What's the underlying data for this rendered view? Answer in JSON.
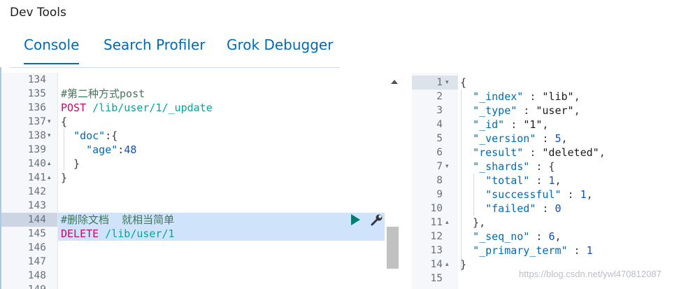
{
  "app": {
    "title": "Dev Tools"
  },
  "tabs": [
    {
      "label": "Console",
      "active": true
    },
    {
      "label": "Search Profiler",
      "active": false
    },
    {
      "label": "Grok Debugger",
      "active": false
    }
  ],
  "request_editor": {
    "lines": [
      {
        "n": "134",
        "fold": "",
        "tokens": []
      },
      {
        "n": "135",
        "fold": "",
        "tokens": [
          {
            "t": "#第二种方式post",
            "c": "comment"
          }
        ]
      },
      {
        "n": "136",
        "fold": "",
        "tokens": [
          {
            "t": "POST ",
            "c": "method"
          },
          {
            "t": "/lib/user/1/_update",
            "c": "url"
          }
        ]
      },
      {
        "n": "137",
        "fold": "▾",
        "tokens": [
          {
            "t": "{",
            "c": "plain"
          }
        ]
      },
      {
        "n": "138",
        "fold": "▾",
        "tokens": [
          {
            "t": "  ",
            "c": "plain"
          },
          {
            "t": "\"doc\"",
            "c": "key"
          },
          {
            "t": ":{",
            "c": "plain"
          }
        ]
      },
      {
        "n": "139",
        "fold": "",
        "tokens": [
          {
            "t": "    ",
            "c": "plain"
          },
          {
            "t": "\"age\"",
            "c": "key"
          },
          {
            "t": ":",
            "c": "plain"
          },
          {
            "t": "48",
            "c": "num"
          }
        ]
      },
      {
        "n": "140",
        "fold": "▴",
        "tokens": [
          {
            "t": "  }",
            "c": "plain"
          }
        ]
      },
      {
        "n": "141",
        "fold": "▴",
        "tokens": [
          {
            "t": "}",
            "c": "plain"
          }
        ]
      },
      {
        "n": "142",
        "fold": "",
        "tokens": []
      },
      {
        "n": "143",
        "fold": "",
        "tokens": []
      },
      {
        "n": "144",
        "fold": "",
        "tokens": [
          {
            "t": "#删除文档  就相当简单",
            "c": "comment"
          }
        ]
      },
      {
        "n": "145",
        "fold": "",
        "tokens": [
          {
            "t": "DELETE ",
            "c": "method"
          },
          {
            "t": "/lib/user/1",
            "c": "url"
          }
        ]
      },
      {
        "n": "146",
        "fold": "",
        "tokens": []
      },
      {
        "n": "147",
        "fold": "",
        "tokens": []
      },
      {
        "n": "148",
        "fold": "",
        "tokens": []
      },
      {
        "n": "149",
        "fold": "",
        "tokens": []
      }
    ],
    "selected_lines": [
      "144",
      "145"
    ],
    "icons": [
      "play-icon",
      "wrench-icon"
    ]
  },
  "response_viewer": {
    "lines": [
      {
        "n": "1",
        "fold": "▾",
        "tokens": [
          {
            "t": "{",
            "c": "plain"
          }
        ]
      },
      {
        "n": "2",
        "fold": "",
        "tokens": [
          {
            "t": "  ",
            "c": "plain"
          },
          {
            "t": "\"_index\"",
            "c": "key"
          },
          {
            "t": " : ",
            "c": "plain"
          },
          {
            "t": "\"lib\"",
            "c": "str"
          },
          {
            "t": ",",
            "c": "plain"
          }
        ]
      },
      {
        "n": "3",
        "fold": "",
        "tokens": [
          {
            "t": "  ",
            "c": "plain"
          },
          {
            "t": "\"_type\"",
            "c": "key"
          },
          {
            "t": " : ",
            "c": "plain"
          },
          {
            "t": "\"user\"",
            "c": "str"
          },
          {
            "t": ",",
            "c": "plain"
          }
        ]
      },
      {
        "n": "4",
        "fold": "",
        "tokens": [
          {
            "t": "  ",
            "c": "plain"
          },
          {
            "t": "\"_id\"",
            "c": "key"
          },
          {
            "t": " : ",
            "c": "plain"
          },
          {
            "t": "\"1\"",
            "c": "str"
          },
          {
            "t": ",",
            "c": "plain"
          }
        ]
      },
      {
        "n": "5",
        "fold": "",
        "tokens": [
          {
            "t": "  ",
            "c": "plain"
          },
          {
            "t": "\"_version\"",
            "c": "key"
          },
          {
            "t": " : ",
            "c": "plain"
          },
          {
            "t": "5",
            "c": "num"
          },
          {
            "t": ",",
            "c": "plain"
          }
        ]
      },
      {
        "n": "6",
        "fold": "",
        "tokens": [
          {
            "t": "  ",
            "c": "plain"
          },
          {
            "t": "\"result\"",
            "c": "key"
          },
          {
            "t": " : ",
            "c": "plain"
          },
          {
            "t": "\"deleted\"",
            "c": "str"
          },
          {
            "t": ",",
            "c": "plain"
          }
        ]
      },
      {
        "n": "7",
        "fold": "▾",
        "tokens": [
          {
            "t": "  ",
            "c": "plain"
          },
          {
            "t": "\"_shards\"",
            "c": "key"
          },
          {
            "t": " : {",
            "c": "plain"
          }
        ]
      },
      {
        "n": "8",
        "fold": "",
        "tokens": [
          {
            "t": "    ",
            "c": "plain"
          },
          {
            "t": "\"total\"",
            "c": "key"
          },
          {
            "t": " : ",
            "c": "plain"
          },
          {
            "t": "1",
            "c": "num"
          },
          {
            "t": ",",
            "c": "plain"
          }
        ]
      },
      {
        "n": "9",
        "fold": "",
        "tokens": [
          {
            "t": "    ",
            "c": "plain"
          },
          {
            "t": "\"successful\"",
            "c": "key"
          },
          {
            "t": " : ",
            "c": "plain"
          },
          {
            "t": "1",
            "c": "num"
          },
          {
            "t": ",",
            "c": "plain"
          }
        ]
      },
      {
        "n": "10",
        "fold": "",
        "tokens": [
          {
            "t": "    ",
            "c": "plain"
          },
          {
            "t": "\"failed\"",
            "c": "key"
          },
          {
            "t": " : ",
            "c": "plain"
          },
          {
            "t": "0",
            "c": "num"
          }
        ]
      },
      {
        "n": "11",
        "fold": "▴",
        "tokens": [
          {
            "t": "  },",
            "c": "plain"
          }
        ]
      },
      {
        "n": "12",
        "fold": "",
        "tokens": [
          {
            "t": "  ",
            "c": "plain"
          },
          {
            "t": "\"_seq_no\"",
            "c": "key"
          },
          {
            "t": " : ",
            "c": "plain"
          },
          {
            "t": "6",
            "c": "num"
          },
          {
            "t": ",",
            "c": "plain"
          }
        ]
      },
      {
        "n": "13",
        "fold": "",
        "tokens": [
          {
            "t": "  ",
            "c": "plain"
          },
          {
            "t": "\"_primary_term\"",
            "c": "key"
          },
          {
            "t": " : ",
            "c": "plain"
          },
          {
            "t": "1",
            "c": "num"
          }
        ]
      },
      {
        "n": "14",
        "fold": "▴",
        "tokens": [
          {
            "t": "}",
            "c": "plain"
          }
        ]
      },
      {
        "n": "15",
        "fold": "",
        "tokens": []
      }
    ]
  },
  "watermark": "https://blog.csdn.net/ywl470812087",
  "colors": {
    "accent": "#006bb4",
    "method": "#c80a68",
    "url": "#00a69b",
    "comment": "#41755c",
    "selection": "#cfe4fb",
    "run": "#017d73"
  }
}
